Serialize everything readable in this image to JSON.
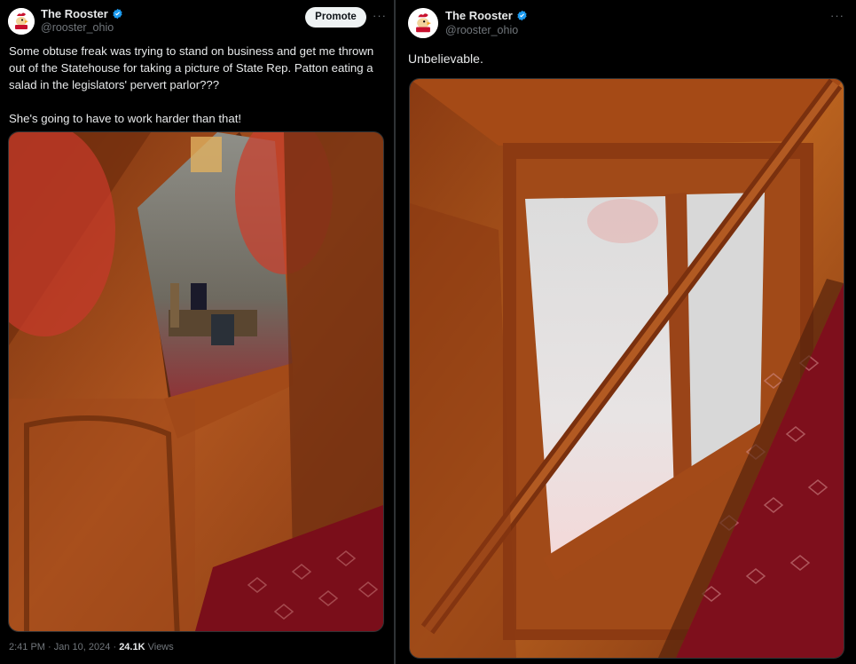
{
  "left_tweet": {
    "author_name": "The Rooster",
    "author_handle": "@rooster_ohio",
    "promote_label": "Promote",
    "more_label": "···",
    "text_line1": "Some obtuse freak was trying to stand on business and get me thrown out of the Statehouse for taking a picture of State Rep. Patton eating a salad in the legislators' pervert parlor???",
    "text_line2": "She's going to have to work harder than that!",
    "time": "2:41 PM",
    "separator1": "·",
    "date": "Jan 10, 2024",
    "separator2": "·",
    "views_count": "24.1K",
    "views_label": "Views"
  },
  "right_tweet": {
    "author_name": "The Rooster",
    "author_handle": "@rooster_ohio",
    "more_label": "···",
    "text": "Unbelievable."
  },
  "icons": {
    "verified": "verified-badge-icon",
    "avatar": "rooster-logo-avatar"
  },
  "colors": {
    "background": "#000000",
    "text": "#e7e9ea",
    "muted": "#71767b",
    "verified": "#1d9bf0",
    "wood": "#a8501c",
    "carpet": "#8a1020"
  }
}
